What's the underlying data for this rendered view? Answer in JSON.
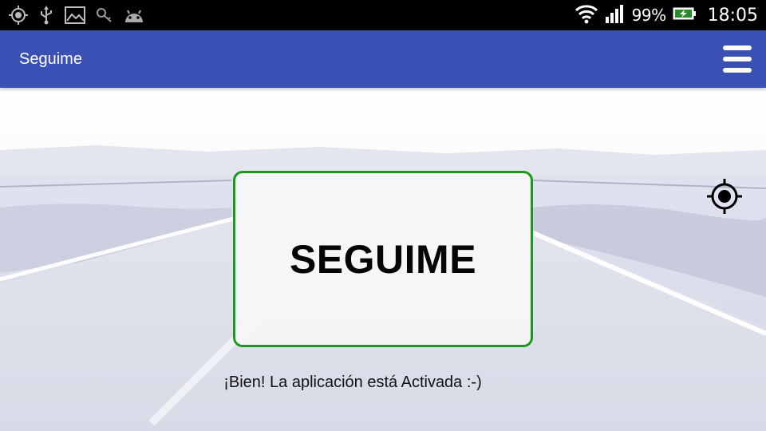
{
  "status_bar": {
    "left_icons": [
      "gps-icon",
      "usb-icon",
      "image-icon",
      "key-icon",
      "android-icon"
    ],
    "battery_percent": "99%",
    "time": "18:05"
  },
  "app_bar": {
    "title": "Seguime",
    "menu_icon": "hamburger-menu-icon",
    "color": "#3a50b5"
  },
  "main": {
    "button_label": "SEGUIME",
    "button_border_color": "#1a9a1a",
    "status_message": "¡Bien! La aplicación está Activada :-)",
    "locate_icon": "crosshair-target-icon"
  }
}
